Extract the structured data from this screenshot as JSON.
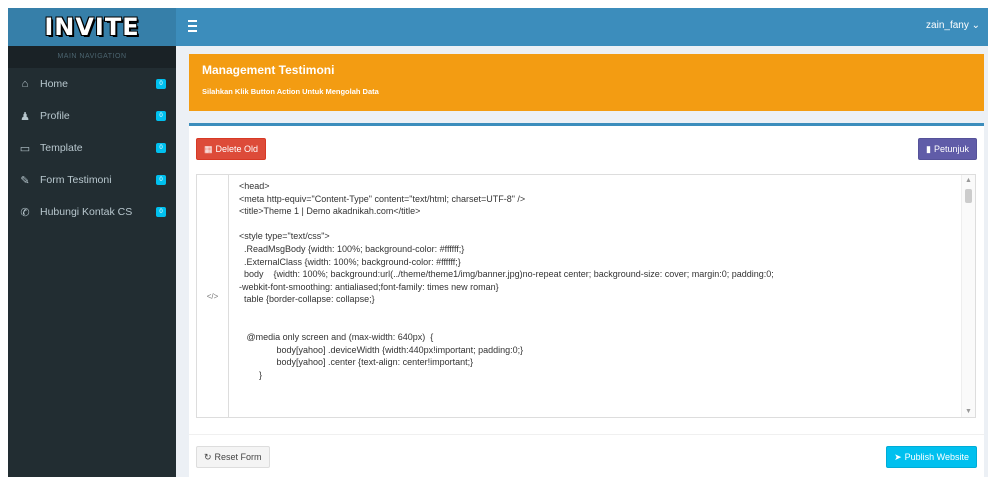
{
  "app": {
    "logo_text": "INVITE",
    "brand_color": "#3c8dbc",
    "sidebar_color": "#222d32"
  },
  "topbar": {
    "toggle_icon": "bars-icon",
    "user_label": "zain_fany ⌄"
  },
  "sidebar": {
    "header": "MAIN NAVIGATION",
    "items": [
      {
        "label": "Home",
        "icon": "home-icon",
        "glyph": "⌂",
        "badge": "0"
      },
      {
        "label": "Profile",
        "icon": "user-icon",
        "glyph": "♟",
        "badge": "0"
      },
      {
        "label": "Template",
        "icon": "monitor-icon",
        "glyph": "▭",
        "badge": "0"
      },
      {
        "label": "Form Testimoni",
        "icon": "edit-icon",
        "glyph": "✎",
        "badge": "0"
      },
      {
        "label": "Hubungi Kontak CS",
        "icon": "phone-icon",
        "glyph": "✆",
        "badge": "0"
      }
    ]
  },
  "callout": {
    "title": "Management Testimoni",
    "subtitle": "Silahkan Klik Button Action Untuk Mengolah Data",
    "color": "#f39c12"
  },
  "buttons": {
    "delete_old": "Delete Old",
    "petunjuk": "Petunjuk",
    "reset_form": "Reset Form",
    "publish": "Publish Website"
  },
  "editor": {
    "gutter_symbol": "</>",
    "code": "<head>\n<meta http-equiv=\"Content-Type\" content=\"text/html; charset=UTF-8\" />\n<title>Theme 1 | Demo akadnikah.com</title>\n\n<style type=\"text/css\">\n  .ReadMsgBody {width: 100%; background-color: #ffffff;}\n  .ExternalClass {width: 100%; background-color: #ffffff;}\n  body    {width: 100%; background:url(../theme/theme1/img/banner.jpg)no-repeat center; background-size: cover; margin:0; padding:0;\n-webkit-font-smoothing: antialiased;font-family: times new roman}\n  table {border-collapse: collapse;}\n\n\n   @media only screen and (max-width: 640px)  {\n               body[yahoo] .deviceWidth {width:440px!important; padding:0;}\n               body[yahoo] .center {text-align: center!important;}\n        }"
  }
}
